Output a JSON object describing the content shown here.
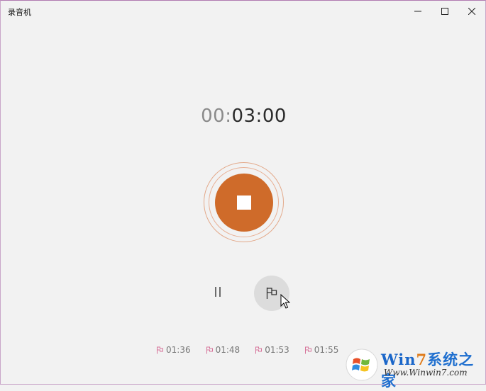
{
  "window": {
    "title": "录音机",
    "controls": {
      "minimize": "minimize-icon",
      "maximize": "maximize-icon",
      "close": "close-icon"
    }
  },
  "timer": {
    "hours": "00",
    "sep1": ":",
    "minutes": "03",
    "sep2": ":",
    "seconds": "00"
  },
  "recorder": {
    "accent_color": "#cf6b2a",
    "stop_icon": "stop-icon",
    "pause_icon": "pause-icon",
    "marker_icon": "flag-icon"
  },
  "markers": [
    {
      "time": "01:36"
    },
    {
      "time": "01:48"
    },
    {
      "time": "01:53"
    },
    {
      "time": "01:55"
    }
  ],
  "watermark": {
    "brand_w": "Win",
    "brand_7": "7",
    "brand_rest": "系统之家",
    "url": "Www.Winwin7.com"
  }
}
